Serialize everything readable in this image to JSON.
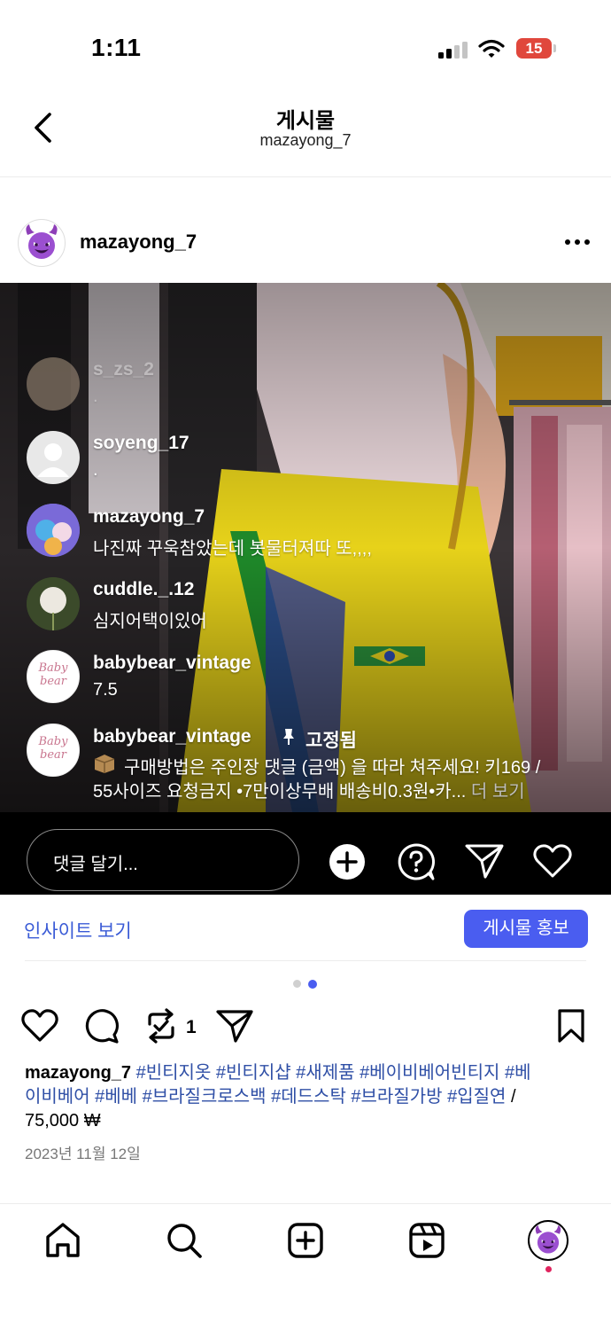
{
  "status_bar": {
    "time": "1:11",
    "battery": "15"
  },
  "header": {
    "title": "게시물",
    "subtitle": "mazayong_7"
  },
  "post": {
    "username": "mazayong_7",
    "more_label": "•••"
  },
  "live_comments": [
    {
      "username": "s_zs_2",
      "text": "."
    },
    {
      "username": "soyeng_17",
      "text": "."
    },
    {
      "username": "mazayong_7",
      "text": "나진짜 꾸욱참았는데 봇물터져따 또,,,,"
    },
    {
      "username": "cuddle._.12",
      "text": "심지어택이있어"
    },
    {
      "username": "babybear_vintage",
      "text": "7.5"
    },
    {
      "username": "babybear_vintage",
      "pinned_label": "고정됨",
      "text_line1": "구매방법은 주인장 댓글 (금액) 을 따라 쳐주세요! 키169 /",
      "text_line2": "55사이즈 요청금지 •7만이상무배 배송비0.3원•카...",
      "more": "더 보기"
    }
  ],
  "avatar_label": "Baby bear",
  "comment_input": {
    "placeholder": "댓글 달기..."
  },
  "insights": {
    "link": "인사이트 보기",
    "boost": "게시물 홍보"
  },
  "actions": {
    "repost_count": "1"
  },
  "caption": {
    "username": "mazayong_7",
    "hashtags_line1": "#빈티지옷 #빈티지샵 #새제품 #베이비베어빈티지 #베",
    "hashtags_line2": "이비베어 #베베 #브라질크로스백 #데드스탁 #브라질가방 #입질연",
    "trail": " /",
    "price": "75,000 ₩"
  },
  "date": "2023년 11월 12일",
  "colors": {
    "accent": "#4a5df0",
    "link": "#3a5bd6",
    "hashtag": "#2f4fa6",
    "notification": "#e0245e"
  }
}
